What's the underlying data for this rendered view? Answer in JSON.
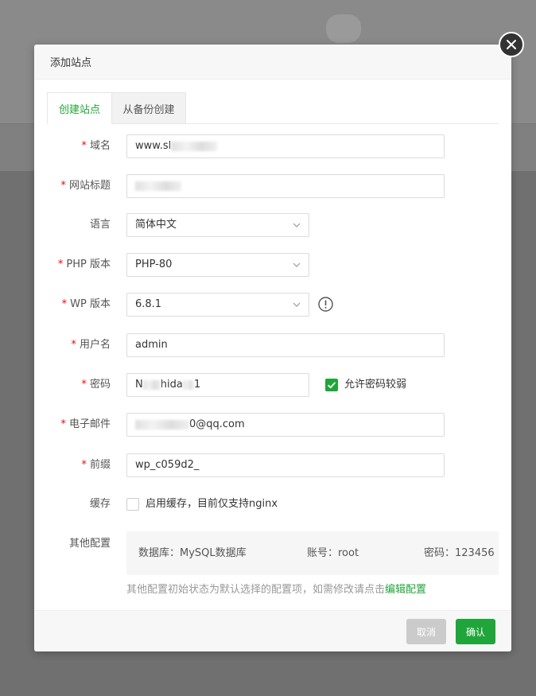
{
  "dialog": {
    "title": "添加站点"
  },
  "tabs": [
    {
      "label": "创建站点",
      "active": true
    },
    {
      "label": "从备份创建",
      "active": false
    }
  ],
  "fields": {
    "domain": {
      "label": "域名",
      "value": "www.sl"
    },
    "site_title": {
      "label": "网站标题",
      "value": ""
    },
    "language": {
      "label": "语言",
      "value": "简体中文"
    },
    "php_version": {
      "label": "PHP 版本",
      "value": "PHP-80"
    },
    "wp_version": {
      "label": "WP 版本",
      "value": "6.8.1"
    },
    "username": {
      "label": "用户名",
      "value": "admin"
    },
    "password": {
      "label": "密码",
      "value_start": "N",
      "value_mid": "hida",
      "value_end": "1",
      "allow_weak_label": "允许密码较弱"
    },
    "email": {
      "label": "电子邮件",
      "value_suffix": "0@qq.com"
    },
    "prefix": {
      "label": "前缀",
      "value": "wp_c059d2_"
    },
    "cache": {
      "label": "缓存",
      "option_label": "启用缓存，目前仅支持nginx"
    },
    "other": {
      "label": "其他配置",
      "database": "数据库：MySQL数据库",
      "account": "账号：root",
      "password": "密码：123456"
    }
  },
  "hint": {
    "text": "其他配置初始状态为默认选择的配置项，如需修改请点击",
    "link": "编辑配置"
  },
  "buttons": {
    "cancel": "取消",
    "confirm": "确认"
  },
  "colors": {
    "accent": "#20a53a",
    "required": "#ef0808",
    "cancel_bg": "#cbcbcb"
  }
}
